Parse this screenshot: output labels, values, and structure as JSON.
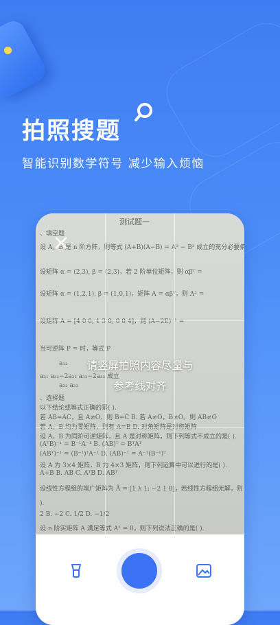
{
  "promo": {
    "headline": "拍照搜题",
    "subline": "智能识别数学符号  减少输入烦恼"
  },
  "camera": {
    "hint_line1": "请竖屏拍照内容尽量与",
    "hint_line2": "参考线对齐",
    "paper_text": [
      "测试题一",
      "、填空题",
      "设 A，B 是 n 阶方阵，则等式 (A+B)(A−B) = A² − B² 成立的充分必要条件",
      "设矩阵 α = (2,3), β = (2,3)，若 2 阶单位矩阵，则 αβᵀ =",
      "设矩阵 α = (1,2,1), β = (1,0,1)，矩阵 A = αβᵀ，则 A² =",
      "设矩阵 A = [4 0 0; 1 3 0; 0 0 4]，则 (A−2E)⁻¹ =",
      "当可逆阵 P =                  时，等式 P",
      "a₁₂",
      "a₃₁  a₃₂−2a₃₂  a₃₃−2a₃₃    成立",
      "a₂₂              a₂₃",
      "、选择题",
      "以下结论或等式正确的是(        ).",
      "若 AB=AC，且 A≠O，则 B=C            B. 若 A≠O，B≠O，则 AB≠O",
      "若 A，B 均为零矩阵，则有 A=B          D. 对角矩阵是对称矩阵",
      "设 A，B 为同阶可逆矩阵，且 A 是对称矩阵，则下列等式不成立的是(     ).",
      "(AᵀB)⁻¹ = B⁻¹A⁻¹                  B. (AB)ᵀ = BᵀAᵀ",
      "(ABᵀ)⁻¹ = (B⁻¹)ᵀA⁻¹              D. (AB)⁻¹ = A⁻¹(B⁻¹)ᵀ",
      "设 A 为 3×4 矩阵，B 为 4×3 矩阵，则下列运算中可以进行的是(      ).",
      "A+B            B. AB               C. AᵀB            D. ABᵀ",
      "设线性方程组的增广矩阵为 Ã = [1 λ 1; −2 1 0]，若线性方程组无解，则 λ 的值",
      ").",
      "2              B. −2               C. 1/2             D. −1/2",
      "设 n 阶实矩阵 A 满足等式 A² = 0，则下列说法正确的是(      )."
    ]
  },
  "icons": {
    "close": "close-icon",
    "search": "search-icon",
    "flashlight": "flashlight-icon",
    "gallery": "gallery-icon"
  },
  "colors": {
    "brand_blue": "#3b73f4",
    "accent_yellow": "#ffd957"
  }
}
